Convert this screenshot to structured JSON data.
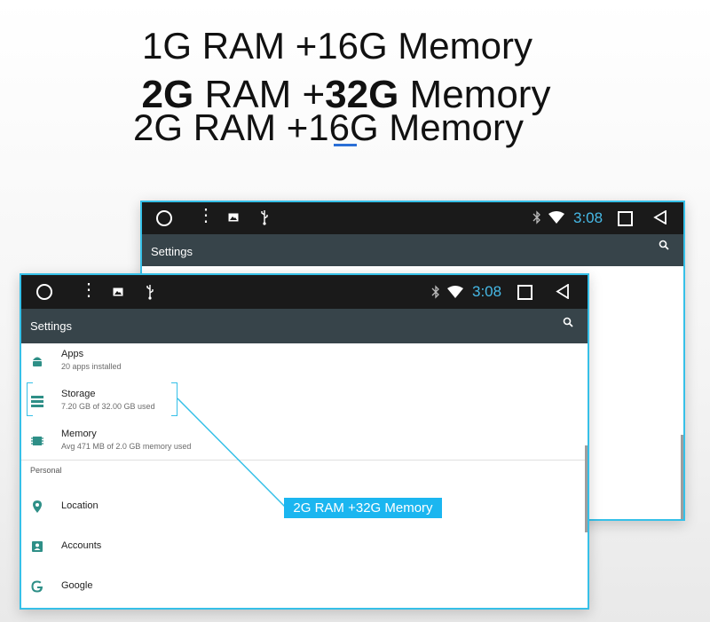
{
  "headlines": {
    "line1": "1G RAM +16G Memory",
    "line2_ram_num": "2G",
    "line2_ram": " RAM +",
    "line2_mem_num": "32G",
    "line2_mem": " Memory",
    "line3": "2G RAM +16G Memory"
  },
  "status_bar": {
    "time": "3:08"
  },
  "toolbar": {
    "title": "Settings",
    "search_icon": "search-icon"
  },
  "settings": {
    "device_items": [
      {
        "icon": "android-icon",
        "title": "Apps",
        "subtitle": "20 apps installed"
      },
      {
        "icon": "storage-icon",
        "title": "Storage",
        "subtitle": "7.20 GB of 32.00 GB used"
      },
      {
        "icon": "memory-chip-icon",
        "title": "Memory",
        "subtitle": "Avg 471 MB of 2.0 GB memory used"
      }
    ],
    "personal_header": "Personal",
    "personal_items": [
      {
        "icon": "location-icon",
        "title": "Location"
      },
      {
        "icon": "accounts-icon",
        "title": "Accounts"
      },
      {
        "icon": "google-icon",
        "title": "Google"
      }
    ]
  },
  "callout": {
    "label": "2G RAM +32G Memory"
  },
  "colors": {
    "accent": "#36c0e8",
    "callout_bg": "#1bb6f0",
    "toolbar": "#37444a",
    "statusbar": "#1a1a1a",
    "icon_teal": "#2e8f87"
  }
}
